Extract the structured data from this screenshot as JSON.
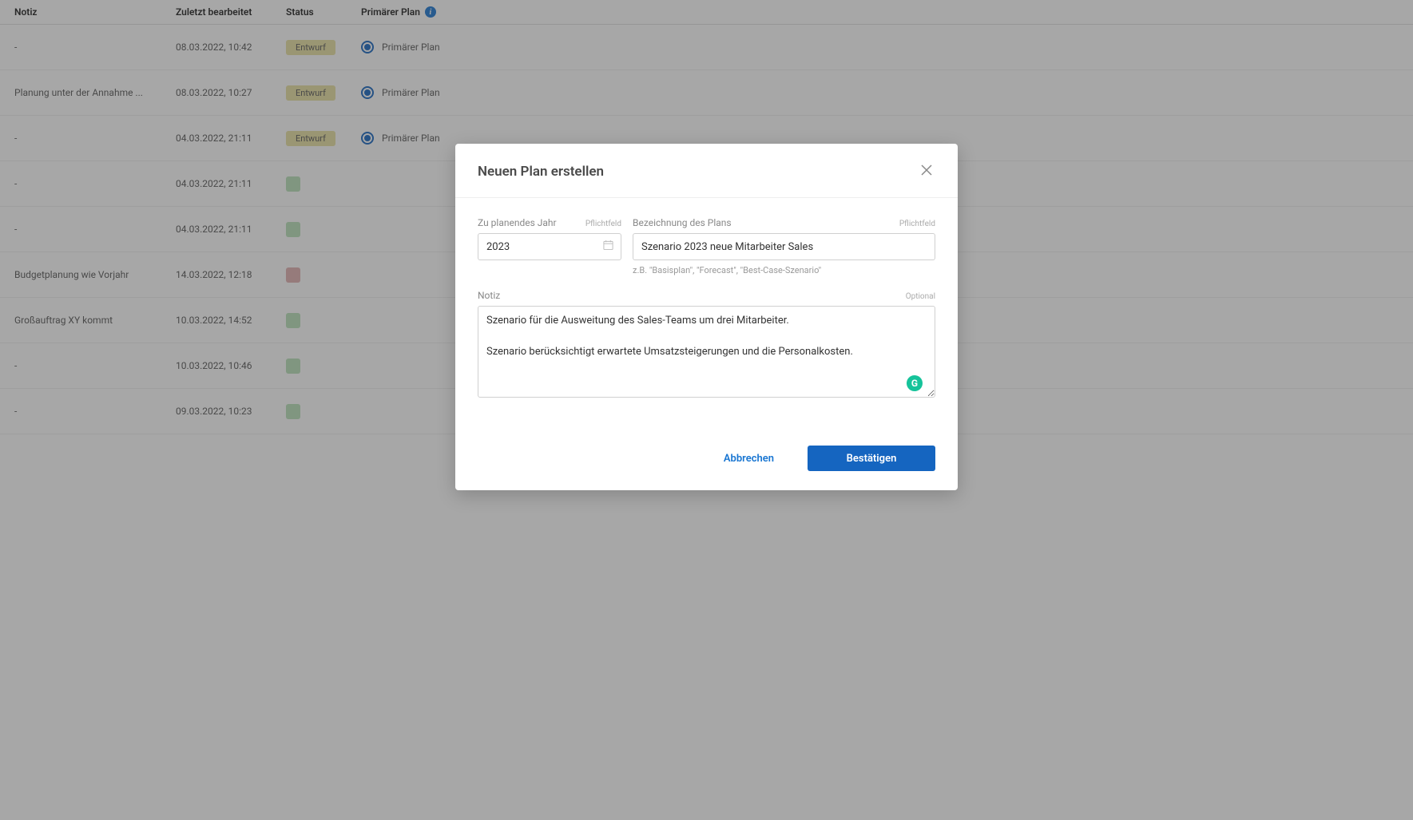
{
  "table": {
    "headers": {
      "notiz": "Notiz",
      "zuletzt": "Zuletzt bearbeitet",
      "status": "Status",
      "primaer": "Primärer Plan"
    },
    "primaer_label": "Primärer Plan",
    "rows": [
      {
        "notiz": "-",
        "zuletzt": "08.03.2022, 10:42",
        "status": "Entwurf",
        "status_type": "entwurf",
        "show_primaer": true
      },
      {
        "notiz": "Planung unter der Annahme ...",
        "zuletzt": "08.03.2022, 10:27",
        "status": "Entwurf",
        "status_type": "entwurf",
        "show_primaer": true
      },
      {
        "notiz": "-",
        "zuletzt": "04.03.2022, 21:11",
        "status": "Entwurf",
        "status_type": "entwurf",
        "show_primaer": true
      },
      {
        "notiz": "-",
        "zuletzt": "04.03.2022, 21:11",
        "status": "",
        "status_type": "green",
        "show_primaer": false
      },
      {
        "notiz": "-",
        "zuletzt": "04.03.2022, 21:11",
        "status": "",
        "status_type": "green",
        "show_primaer": false
      },
      {
        "notiz": "Budgetplanung wie Vorjahr",
        "zuletzt": "14.03.2022, 12:18",
        "status": "",
        "status_type": "red",
        "show_primaer": false
      },
      {
        "notiz": "Großauftrag XY kommt",
        "zuletzt": "10.03.2022, 14:52",
        "status": "",
        "status_type": "green",
        "show_primaer": false
      },
      {
        "notiz": "-",
        "zuletzt": "10.03.2022, 10:46",
        "status": "",
        "status_type": "green",
        "show_primaer": false
      },
      {
        "notiz": "-",
        "zuletzt": "09.03.2022, 10:23",
        "status": "",
        "status_type": "green",
        "show_primaer": false
      }
    ]
  },
  "modal": {
    "title": "Neuen Plan erstellen",
    "year": {
      "label": "Zu planendes Jahr",
      "hint": "Pflichtfeld",
      "value": "2023"
    },
    "name": {
      "label": "Bezeichnung des Plans",
      "hint": "Pflichtfeld",
      "value": "Szenario 2023 neue Mitarbeiter Sales",
      "help": "z.B. \"Basisplan\", \"Forecast\", \"Best-Case-Szenario\""
    },
    "notiz": {
      "label": "Notiz",
      "hint": "Optional",
      "value": "Szenario für die Ausweitung des Sales-Teams um drei Mitarbeiter.\n\nSzenario berücksichtigt erwartete Umsatzsteigerungen und die Personalkosten."
    },
    "cancel": "Abbrechen",
    "confirm": "Bestätigen"
  }
}
